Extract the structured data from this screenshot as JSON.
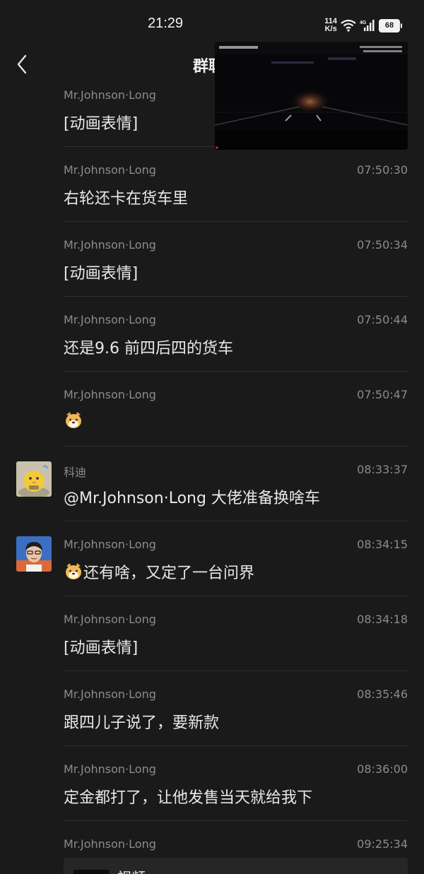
{
  "status_bar": {
    "time": "21:29",
    "net_speed_value": "114",
    "net_speed_unit": "K/s",
    "battery": "68"
  },
  "header": {
    "title": "群聊"
  },
  "messages": [
    {
      "sender": "Mr.Johnson·Long",
      "time": "",
      "text": "[动画表情]"
    },
    {
      "sender": "Mr.Johnson·Long",
      "time": "07:50:30",
      "text": "右轮还卡在货车里"
    },
    {
      "sender": "Mr.Johnson·Long",
      "time": "07:50:34",
      "text": "[动画表情]"
    },
    {
      "sender": "Mr.Johnson·Long",
      "time": "07:50:44",
      "text": "还是9.6 前四后四的货车"
    },
    {
      "sender": "Mr.Johnson·Long",
      "time": "07:50:47",
      "text": ""
    },
    {
      "sender": "科迪",
      "time": "08:33:37",
      "text": "@Mr.Johnson·Long 大佬准备换啥车"
    },
    {
      "sender": "Mr.Johnson·Long",
      "time": "08:34:15",
      "text": "还有啥，又定了一台问界"
    },
    {
      "sender": "Mr.Johnson·Long",
      "time": "08:34:18",
      "text": "[动画表情]"
    },
    {
      "sender": "Mr.Johnson·Long",
      "time": "08:35:46",
      "text": "跟四儿子说了，要新款"
    },
    {
      "sender": "Mr.Johnson·Long",
      "time": "08:36:00",
      "text": "定金都打了，让他发售当天就给我下"
    },
    {
      "sender": "Mr.Johnson·Long",
      "time": "09:25:34",
      "text": "视频"
    }
  ],
  "icons": {
    "back": "chevron-left-icon",
    "emoji": "doge-emoji-icon",
    "wifi": "wifi-icon",
    "signal": "signal-icon",
    "battery": "battery-icon"
  },
  "colors": {
    "background": "#1a1a1a",
    "text_primary": "#e8e8e8",
    "text_secondary": "#8c8c8c",
    "divider": "#2e2e2e"
  }
}
